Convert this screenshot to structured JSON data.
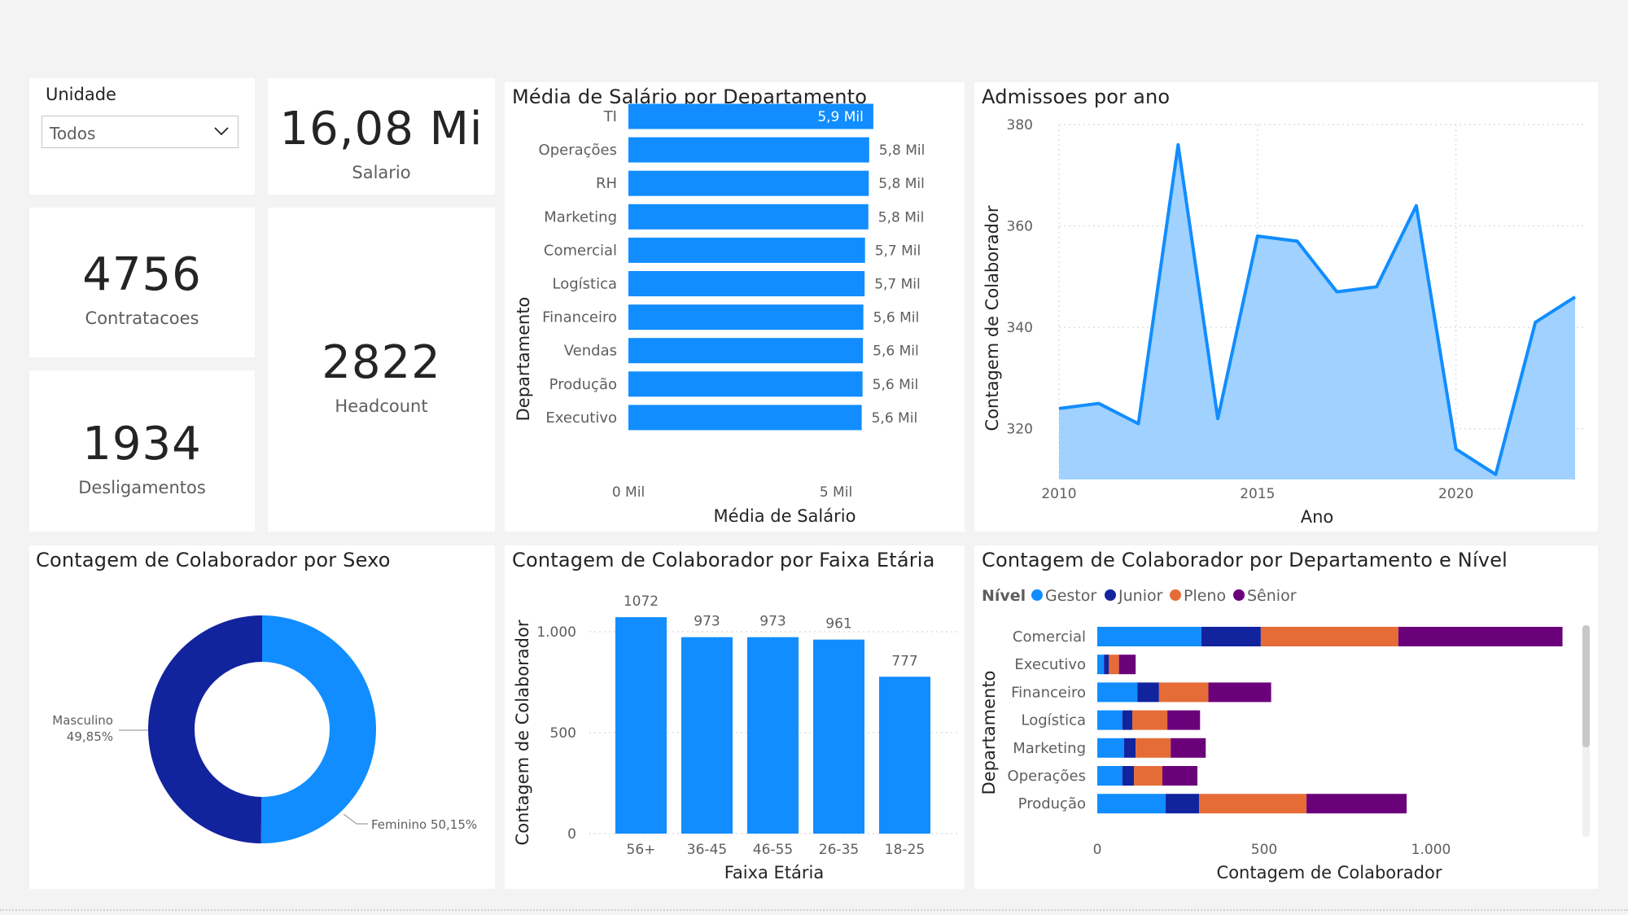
{
  "slicer": {
    "title": "Unidade",
    "selected": "Todos",
    "chevron_icon": "chevron-down-icon"
  },
  "kpis": {
    "salario": {
      "value": "16,08 Mi",
      "label": "Salario"
    },
    "contratacoes": {
      "value": "4756",
      "label": "Contratacoes"
    },
    "desligamentos": {
      "value": "1934",
      "label": "Desligamentos"
    },
    "headcount": {
      "value": "2822",
      "label": "Headcount"
    }
  },
  "colors": {
    "primary": "#118dff",
    "dark": "#12239e",
    "orange": "#e66c37",
    "purple": "#6b007b",
    "area": "#a0d1ff"
  },
  "chart_data": [
    {
      "id": "salario_departamento",
      "type": "bar",
      "orientation": "horizontal",
      "title": "Média de Salário por Departamento",
      "xlabel": "Média de Salário",
      "ylabel": "Departamento",
      "categories": [
        "TI",
        "Operações",
        "RH",
        "Marketing",
        "Comercial",
        "Logística",
        "Financeiro",
        "Vendas",
        "Produção",
        "Executivo"
      ],
      "values": [
        5900,
        5800,
        5790,
        5780,
        5700,
        5690,
        5660,
        5650,
        5640,
        5620
      ],
      "data_labels": [
        "5,9 Mil",
        "5,8 Mil",
        "5,8 Mil",
        "5,8 Mil",
        "5,7 Mil",
        "5,7 Mil",
        "5,6 Mil",
        "5,6 Mil",
        "5,6 Mil",
        "5,6 Mil"
      ],
      "xticks": [
        {
          "value": 0,
          "label": "0 Mil"
        },
        {
          "value": 5000,
          "label": "5 Mil"
        }
      ],
      "xlim": [
        0,
        7000
      ]
    },
    {
      "id": "admissoes_ano",
      "type": "area",
      "title": "Admissoes por ano",
      "xlabel": "Ano",
      "ylabel": "Contagem de Colaborador",
      "x": [
        2010,
        2011,
        2012,
        2013,
        2014,
        2015,
        2016,
        2017,
        2018,
        2019,
        2020,
        2021,
        2022,
        2023
      ],
      "values": [
        324,
        325,
        321,
        376,
        322,
        358,
        357,
        347,
        348,
        364,
        316,
        311,
        341,
        346
      ],
      "xticks": [
        2010,
        2015,
        2020
      ],
      "yticks": [
        320,
        340,
        360,
        380
      ],
      "xlim": [
        2010,
        2023
      ],
      "ylim": [
        310,
        380
      ],
      "grid": true
    },
    {
      "id": "colaborador_sexo",
      "type": "pie",
      "title": "Contagem de Colaborador por Sexo",
      "categories": [
        "Feminino",
        "Masculino"
      ],
      "values": [
        50.15,
        49.85
      ],
      "labels": [
        {
          "name": "Feminino",
          "pct": "50,15%"
        },
        {
          "name": "Masculino",
          "pct": "49,85%"
        }
      ]
    },
    {
      "id": "faixa_etaria",
      "type": "bar",
      "title": "Contagem de Colaborador por Faixa Etária",
      "xlabel": "Faixa Etária",
      "ylabel": "Contagem de Colaborador",
      "categories": [
        "56+",
        "36-45",
        "46-55",
        "26-35",
        "18-25"
      ],
      "values": [
        1072,
        973,
        973,
        961,
        777
      ],
      "yticks": [
        {
          "value": 0,
          "label": "0"
        },
        {
          "value": 500,
          "label": "500"
        },
        {
          "value": 1000,
          "label": "1.000"
        }
      ],
      "ylim": [
        0,
        1150
      ],
      "grid": true
    },
    {
      "id": "departamento_nivel",
      "type": "bar",
      "orientation": "horizontal",
      "stacked": true,
      "title": "Contagem de Colaborador por Departamento e Nível",
      "xlabel": "Contagem de Colaborador",
      "ylabel": "Departamento",
      "legend_title": "Nível",
      "legend_position": "top-left",
      "categories": [
        "Comercial",
        "Executivo",
        "Financeiro",
        "Logística",
        "Marketing",
        "Operações",
        "Produção"
      ],
      "series": [
        {
          "name": "Gestor",
          "values": [
            312,
            20,
            120,
            75,
            80,
            75,
            205
          ]
        },
        {
          "name": "Junior",
          "values": [
            178,
            15,
            65,
            30,
            35,
            35,
            100
          ]
        },
        {
          "name": "Pleno",
          "values": [
            412,
            30,
            148,
            105,
            105,
            85,
            322
          ]
        },
        {
          "name": "Sênior",
          "values": [
            492,
            50,
            188,
            98,
            105,
            105,
            300
          ]
        }
      ],
      "xticks": [
        {
          "value": 0,
          "label": "0"
        },
        {
          "value": 500,
          "label": "500"
        },
        {
          "value": 1000,
          "label": "1.000"
        }
      ],
      "xlim": [
        0,
        1400
      ]
    }
  ]
}
